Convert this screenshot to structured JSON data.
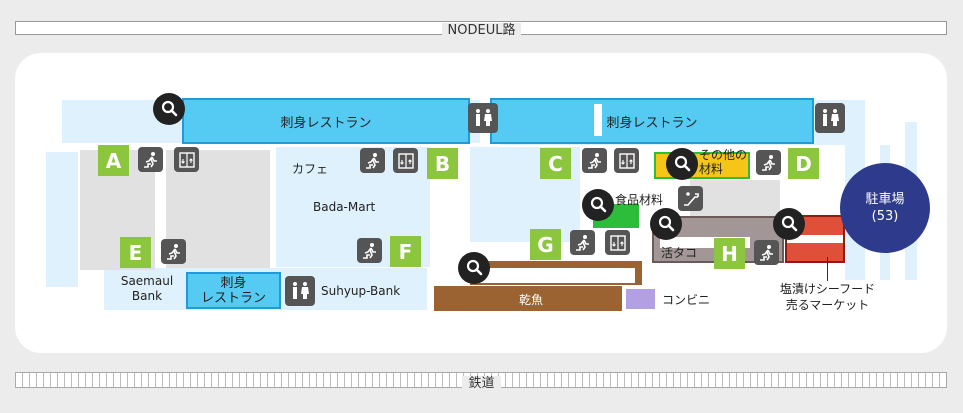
{
  "roads": {
    "top": "NODEUL路",
    "bottom": "鉄道"
  },
  "gates": [
    "A",
    "B",
    "C",
    "D",
    "E",
    "F",
    "G",
    "H"
  ],
  "labels": {
    "restaurant": "刺身レストラン",
    "restaurant_small_l1": "刺身",
    "restaurant_small_l2": "レストラン",
    "cafe": "カフェ",
    "bada_mart": "Bada-Mart",
    "saemaul_l1": "Saemaul",
    "saemaul_l2": "Bank",
    "suhyup": "Suhyup-Bank",
    "sonota_l1": "その他の",
    "sonota_l2": "材料",
    "food": "食品材料",
    "live_octopus": "活タコ",
    "dried_fish": "乾魚",
    "convenience": "コンビニ",
    "seafood_l1": "塩漬けシーフード",
    "seafood_l2": "売るマーケット"
  },
  "parking": {
    "label": "駐車場",
    "count": "(53)"
  },
  "icons": [
    "search-icon",
    "stairs-icon",
    "elevator-icon",
    "restroom-icon",
    "escalator-icon"
  ],
  "colors": {
    "restaurant": "#55cbf3",
    "gate": "#8cc63e",
    "parking": "#2e3a8c",
    "dried_fish": "#9b6232",
    "seafood": "#e04f38",
    "food": "#2ebd3a",
    "convenience": "#b3a0e3"
  }
}
